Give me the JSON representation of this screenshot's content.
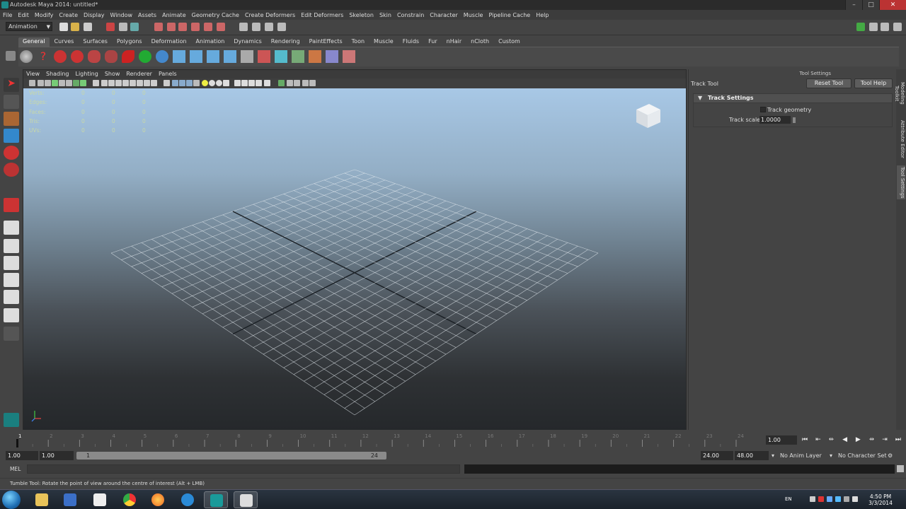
{
  "window": {
    "title": "Autodesk Maya 2014: untitled*"
  },
  "menu": [
    "File",
    "Edit",
    "Modify",
    "Create",
    "Display",
    "Window",
    "Assets",
    "Animate",
    "Geometry Cache",
    "Create Deformers",
    "Edit Deformers",
    "Skeleton",
    "Skin",
    "Constrain",
    "Character",
    "Muscle",
    "Pipeline Cache",
    "Help"
  ],
  "status_line": {
    "mode": "Animation"
  },
  "shelf": {
    "tabs": [
      "General",
      "Curves",
      "Surfaces",
      "Polygons",
      "Deformation",
      "Animation",
      "Dynamics",
      "Rendering",
      "PaintEffects",
      "Toon",
      "Muscle",
      "Fluids",
      "Fur",
      "nHair",
      "nCloth",
      "Custom"
    ],
    "active_tab": "General"
  },
  "viewport": {
    "menu": [
      "View",
      "Shading",
      "Lighting",
      "Show",
      "Renderer",
      "Panels"
    ],
    "hud": [
      {
        "label": "Verts:",
        "v1": "0",
        "v2": "0",
        "v3": "0"
      },
      {
        "label": "Edges:",
        "v1": "0",
        "v2": "0",
        "v3": "0"
      },
      {
        "label": "Faces:",
        "v1": "0",
        "v2": "0",
        "v3": "0"
      },
      {
        "label": "Tris:",
        "v1": "0",
        "v2": "0",
        "v3": "0"
      },
      {
        "label": "UVs:",
        "v1": "0",
        "v2": "0",
        "v3": "0"
      }
    ]
  },
  "tool_settings": {
    "header": "Tool Settings",
    "tool_name": "Track Tool",
    "reset_button": "Reset Tool",
    "help_button": "Tool Help",
    "section": "Track Settings",
    "track_geometry_label": "Track geometry",
    "track_scale_label": "Track scale:",
    "track_scale_value": "1.0000"
  },
  "side_tabs": [
    "Modeling Toolkit",
    "Attribute Editor",
    "Tool Settings"
  ],
  "time_slider": {
    "tick_labels": [
      "1",
      "2",
      "3",
      "4",
      "5",
      "6",
      "7",
      "8",
      "9",
      "10",
      "11",
      "12",
      "13",
      "14",
      "15",
      "16",
      "17",
      "18",
      "19",
      "20",
      "21",
      "22",
      "23",
      "24"
    ],
    "current_frame": "1.00"
  },
  "range_slider": {
    "start": "1.00",
    "playback_start": "1.00",
    "range_start_label": "1",
    "range_end_label": "24",
    "playback_end": "24.00",
    "end": "48.00",
    "anim_layer": "No Anim Layer",
    "character_set": "No Character Set"
  },
  "command_line": {
    "label": "MEL"
  },
  "help_line": {
    "text": "Tumble Tool: Rotate the point of view around the centre of interest (Alt + LMB)"
  },
  "taskbar": {
    "language": "EN",
    "time": "4:50 PM",
    "date": "3/3/2014"
  }
}
